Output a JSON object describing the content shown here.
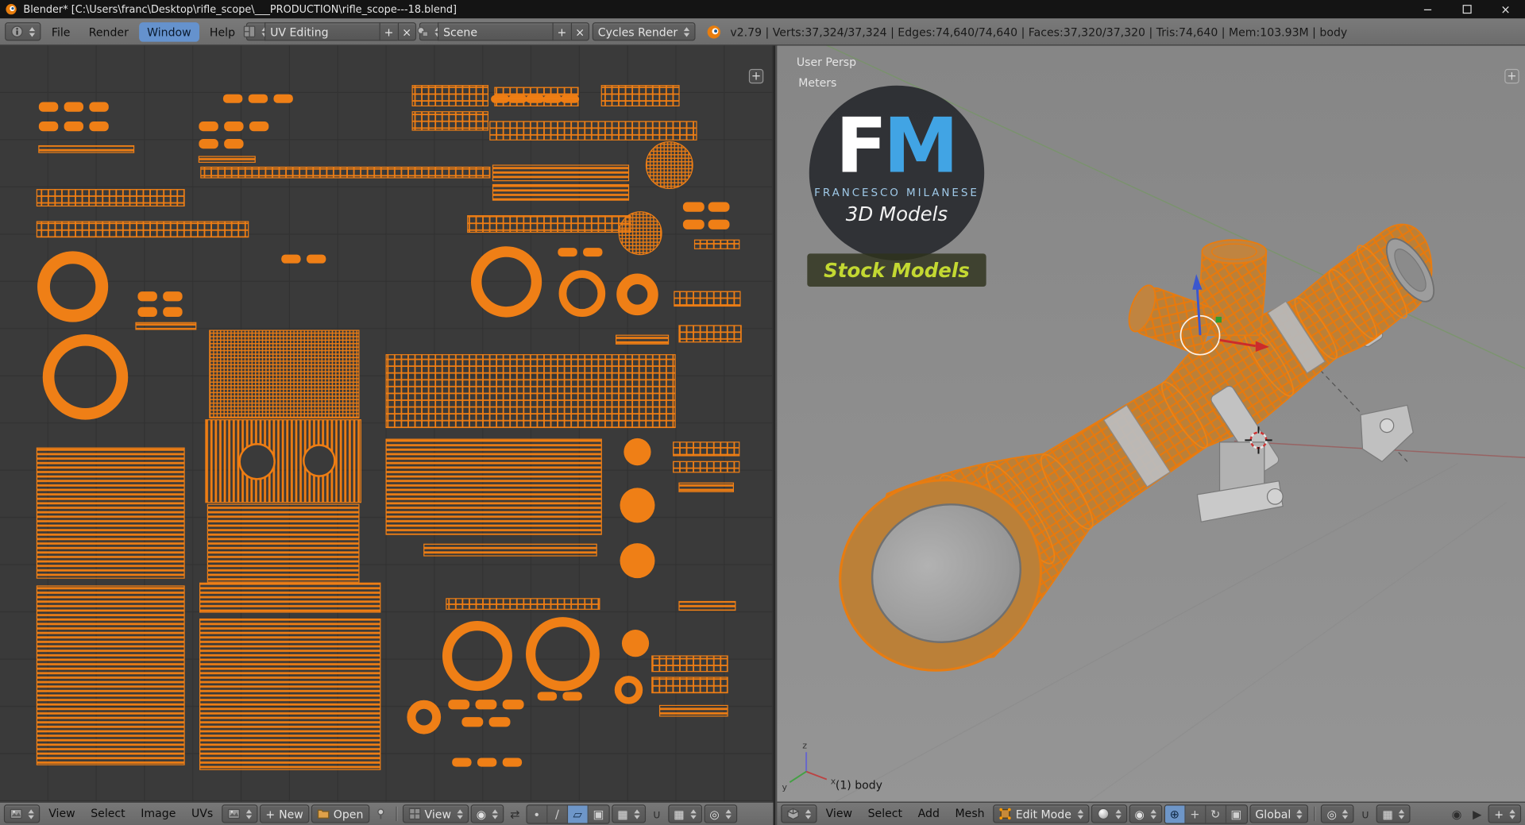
{
  "window": {
    "title": "Blender* [C:\\Users\\franc\\Desktop\\rifle_scope\\___PRODUCTION\\rifle_scope---18.blend]",
    "controls": {
      "minimize": "−",
      "close": "×"
    }
  },
  "infobar": {
    "menus": [
      "File",
      "Render",
      "Window",
      "Help"
    ],
    "active_menu": "Window",
    "layout": {
      "value": "UV Editing",
      "add": "+",
      "close": "×"
    },
    "scene": {
      "value": "Scene",
      "add": "+",
      "close": "×"
    },
    "engine": {
      "value": "Cycles Render"
    },
    "stats": "v2.79 | Verts:37,324/37,324 | Edges:74,640/74,640 | Faces:37,320/37,320 | Tris:74,640 | Mem:103.93M | body"
  },
  "uv_editor": {
    "menus": [
      "View",
      "Select",
      "Image",
      "UVs"
    ],
    "buttons": {
      "new": "New",
      "open": "Open"
    },
    "view_dropdown": "View",
    "corner_plus": "+"
  },
  "viewport": {
    "menus": [
      "View",
      "Select",
      "Add",
      "Mesh"
    ],
    "mode": "Edit Mode",
    "orientation": "Global",
    "overlay": {
      "view_name": "User Persp",
      "units": "Meters",
      "active_object": "(1) body"
    },
    "axis_labels": {
      "x": "x",
      "y": "y",
      "z": "z"
    },
    "logo": {
      "f": "F",
      "m": "M",
      "name": "FRANCESCO MILANESE",
      "subtitle": "3D Models",
      "banner": "Stock Models"
    },
    "corner_plus": "+"
  },
  "icons": {
    "plus": "+",
    "close": "×",
    "sync": "⇄",
    "vertex_mode": "∙",
    "edge_mode": "∕",
    "face_mode": "▱",
    "island_mode": "▣",
    "sticky": "▦",
    "pivot": "◉",
    "proportional": "◎",
    "magnet": "∪",
    "snap_element": "▦",
    "manip_toggle": "⊕",
    "translate": "+",
    "rotate": "↻",
    "scale": "▣",
    "render_still": "◉",
    "render_anim": "▶"
  },
  "colors": {
    "uv_orange": "#ef7f16",
    "selection_blue": "#6e96c8",
    "logo_blue": "#41a4e4",
    "banner_green": "#c3d832"
  }
}
